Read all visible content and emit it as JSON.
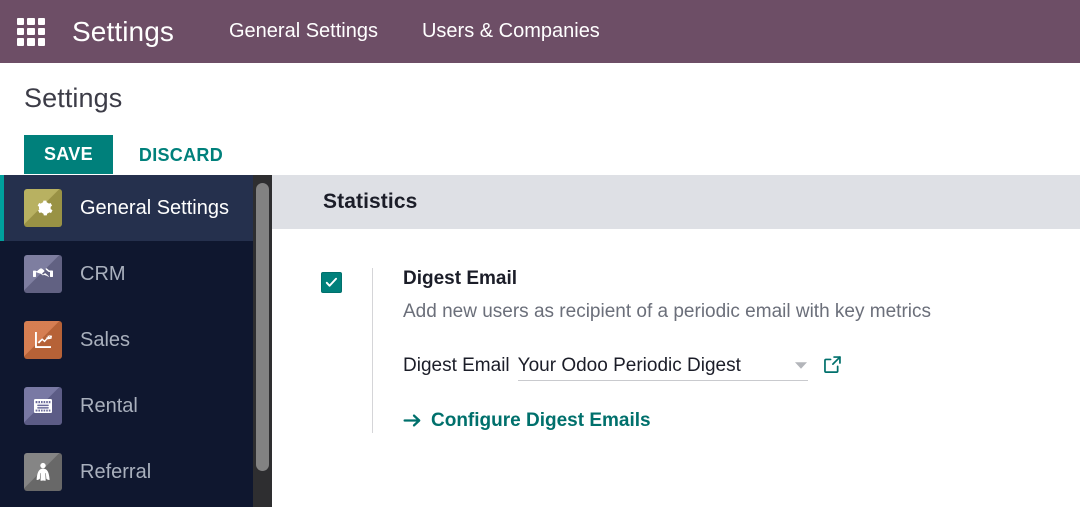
{
  "topbar": {
    "apps_icon": "apps-grid-icon",
    "brand": "Settings",
    "background": "#6d4e66",
    "nav": [
      {
        "label": "General Settings"
      },
      {
        "label": "Users & Companies"
      }
    ]
  },
  "page": {
    "title": "Settings",
    "save_label": "SAVE",
    "discard_label": "DISCARD",
    "accent": "#00807b"
  },
  "sidebar": {
    "background": "#0f172f",
    "active_accent": "#00a09d",
    "items": [
      {
        "label": "General Settings",
        "icon": "gear-icon",
        "icon_bg": "#b0a84f",
        "active": true
      },
      {
        "label": "CRM",
        "icon": "handshake-icon",
        "icon_bg": "#6f6f95",
        "active": false
      },
      {
        "label": "Sales",
        "icon": "chart-up-icon",
        "icon_bg": "#d1703f",
        "active": false
      },
      {
        "label": "Rental",
        "icon": "calendar-icon",
        "icon_bg": "#6a6a9a",
        "active": false
      },
      {
        "label": "Referral",
        "icon": "cape-icon",
        "icon_bg": "#777777",
        "active": false
      }
    ]
  },
  "main": {
    "section_title": "Statistics",
    "setting": {
      "checked": true,
      "name": "Digest Email",
      "description": "Add new users as recipient of a periodic email with key metrics",
      "field_label": "Digest Email",
      "field_value": "Your Odoo Periodic Digest",
      "dropdown_icon": "chevron-down-icon",
      "external_icon": "external-link-icon",
      "config_link": "Configure Digest Emails",
      "config_icon": "arrow-right-icon"
    }
  }
}
